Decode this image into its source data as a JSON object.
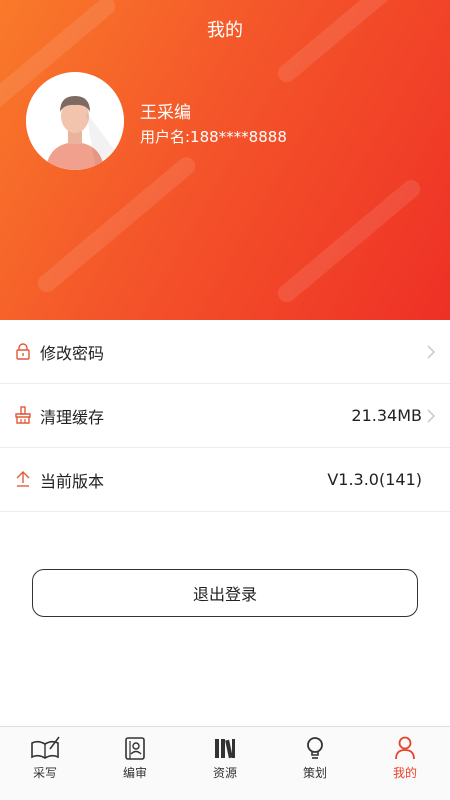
{
  "header": {
    "title": "我的",
    "user_name": "王采编",
    "user_id": "用户名:188****8888"
  },
  "menu": [
    {
      "label": "修改密码",
      "value": "",
      "icon": "lock-icon"
    },
    {
      "label": "清理缓存",
      "value": "21.34MB",
      "icon": "broom-icon"
    },
    {
      "label": "当前版本",
      "value": "V1.3.0(141)",
      "icon": "upload-icon"
    }
  ],
  "logout_label": "退出登录",
  "tabs": [
    {
      "label": "采写",
      "icon": "book-pen-icon"
    },
    {
      "label": "编审",
      "icon": "review-icon"
    },
    {
      "label": "资源",
      "icon": "resources-icon"
    },
    {
      "label": "策划",
      "icon": "lightbulb-icon"
    },
    {
      "label": "我的",
      "icon": "person-icon"
    }
  ],
  "colors": {
    "accent": "#e8432a",
    "header_start": "#f97a2a",
    "header_end": "#ee3026"
  }
}
